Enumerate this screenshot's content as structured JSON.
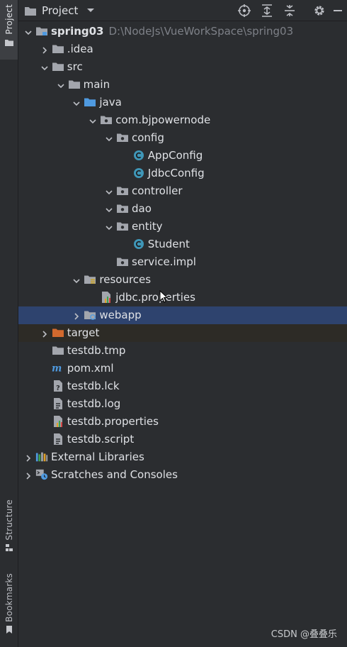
{
  "left_strip": {
    "project_tab": "Project",
    "structure_tab": "Structure",
    "bookmarks_tab": "Bookmarks"
  },
  "header": {
    "title": "Project",
    "icons": [
      "crosshair-icon",
      "expand-all-icon",
      "collapse-all-icon",
      "gear-icon"
    ]
  },
  "tree": [
    {
      "label": "spring03",
      "path": "D:\\NodeJs\\VueWorkSpace\\spring03",
      "level": 0,
      "chevron": "down",
      "icon": "module-folder-icon"
    },
    {
      "label": ".idea",
      "level": 1,
      "chevron": "right",
      "icon": "folder-icon"
    },
    {
      "label": "src",
      "level": 1,
      "chevron": "down",
      "icon": "folder-icon"
    },
    {
      "label": "main",
      "level": 2,
      "chevron": "down",
      "icon": "folder-icon"
    },
    {
      "label": "java",
      "level": 3,
      "chevron": "down",
      "icon": "source-folder-icon"
    },
    {
      "label": "com.bjpowernode",
      "level": 4,
      "chevron": "down",
      "icon": "package-icon"
    },
    {
      "label": "config",
      "level": 5,
      "chevron": "down",
      "icon": "package-icon"
    },
    {
      "label": "AppConfig",
      "level": 6,
      "chevron": "",
      "icon": "class-icon"
    },
    {
      "label": "JdbcConfig",
      "level": 6,
      "chevron": "",
      "icon": "class-icon"
    },
    {
      "label": "controller",
      "level": 5,
      "chevron": "down",
      "icon": "package-icon"
    },
    {
      "label": "dao",
      "level": 5,
      "chevron": "down",
      "icon": "package-icon"
    },
    {
      "label": "entity",
      "level": 5,
      "chevron": "down",
      "icon": "package-icon"
    },
    {
      "label": "Student",
      "level": 6,
      "chevron": "",
      "icon": "class-icon"
    },
    {
      "label": "service.impl",
      "level": 5,
      "chevron": "",
      "icon": "package-icon"
    },
    {
      "label": "resources",
      "level": 3,
      "chevron": "down",
      "icon": "resources-folder-icon"
    },
    {
      "label": "jdbc.properties",
      "level": 4,
      "chevron": "",
      "icon": "properties-file-icon"
    },
    {
      "label": "webapp",
      "level": 3,
      "chevron": "right",
      "icon": "web-folder-icon",
      "selected": true
    },
    {
      "label": "target",
      "level": 1,
      "chevron": "right",
      "icon": "excluded-folder-icon",
      "highlight": true
    },
    {
      "label": "testdb.tmp",
      "level": 1,
      "chevron": "",
      "icon": "folder-icon"
    },
    {
      "label": "pom.xml",
      "level": 1,
      "chevron": "",
      "icon": "maven-icon"
    },
    {
      "label": "testdb.lck",
      "level": 1,
      "chevron": "",
      "icon": "unknown-file-icon"
    },
    {
      "label": "testdb.log",
      "level": 1,
      "chevron": "",
      "icon": "text-file-icon"
    },
    {
      "label": "testdb.properties",
      "level": 1,
      "chevron": "",
      "icon": "properties-file-icon"
    },
    {
      "label": "testdb.script",
      "level": 1,
      "chevron": "",
      "icon": "text-file-icon"
    },
    {
      "label": "External Libraries",
      "level": 0,
      "chevron": "right",
      "icon": "libraries-icon"
    },
    {
      "label": "Scratches and Consoles",
      "level": 0,
      "chevron": "right",
      "icon": "scratches-icon"
    }
  ],
  "watermark": "CSDN @叠叠乐",
  "colors": {
    "background": "#2b2d30",
    "selection": "#2e436e",
    "text": "#dfe1e5",
    "folder": "#a3a6ad",
    "source_folder": "#4f9ae0",
    "class_icon": "#3f97b8",
    "target_folder": "#d2692e"
  }
}
